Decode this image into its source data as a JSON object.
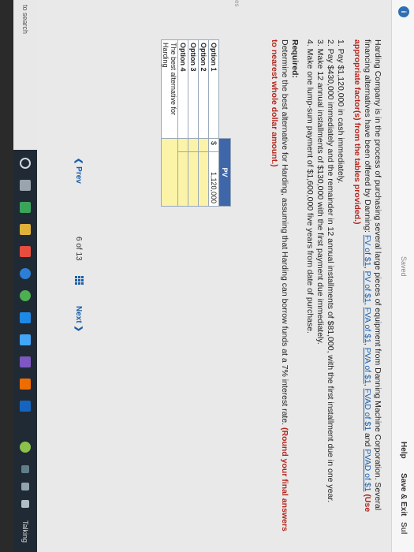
{
  "appbar": {
    "saved": "Saved",
    "help": "Help",
    "save_exit": "Save & Exit",
    "submit": "Sul"
  },
  "question": {
    "intro_1": "Harding Company is in the process of purchasing several large pieces of equipment from Danning Machine Corporation. Several financing alternatives have been offered by Danning:",
    "links": [
      "FV of $1",
      "PV of $1",
      "FVA of $1",
      "PVA of $1",
      "FVAD of $1",
      "PVAD of $1"
    ],
    "and": "and",
    "use_note": "(Use appropriate factor(s) from the tables provided.)",
    "options": [
      "1. Pay $1,120,000 in cash immediately.",
      "2. Pay $430,000 immediately and the remainder in 12 annual installments of $81,000, with the first installment due in one year.",
      "3. Make 12 annual installments of $130,000 with the first payment due immediately.",
      "4. Make one lump-sum payment of $1,600,000 five years from date of purchase."
    ],
    "required_label": "Required:",
    "required_text": "Determine the best alternative for Harding, assuming that Harding can borrow funds at a 7% interest rate.",
    "round_note": "(Round your final answers to nearest whole dollar amount.)"
  },
  "table": {
    "header": "PV",
    "rows": [
      {
        "label": "Option 1",
        "dollar": "$",
        "value": "1,120,000"
      },
      {
        "label": "Option 2",
        "dollar": "",
        "value": ""
      },
      {
        "label": "Option 3",
        "dollar": "",
        "value": ""
      },
      {
        "label": "Option 4",
        "dollar": "",
        "value": ""
      },
      {
        "label": "The best alternative for Harding",
        "dollar": "",
        "value": ""
      }
    ]
  },
  "edge_fragment": "es",
  "pager": {
    "prev": "Prev",
    "current": "6",
    "of": "of",
    "total": "13",
    "next": "Next"
  },
  "taskbar": {
    "search": "to search",
    "talking": "Talking"
  },
  "colors": {
    "accent": "#1a5ea8",
    "header_bg": "#3f66a8",
    "input_bg": "#fbf3a8",
    "alert": "#b3261e"
  }
}
